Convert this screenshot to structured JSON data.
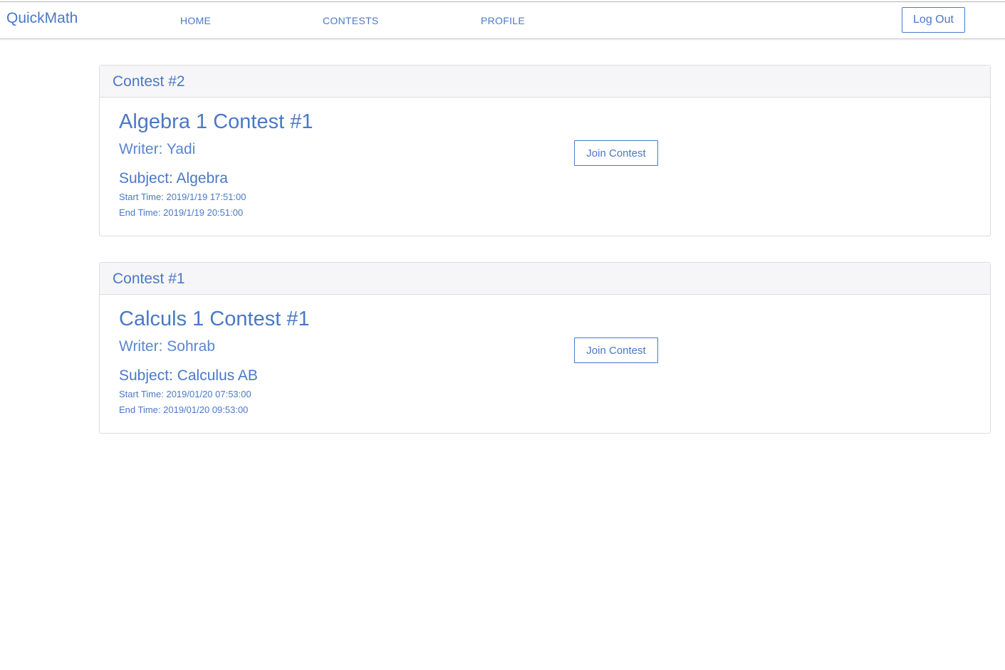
{
  "navbar": {
    "brand": "QuickMath",
    "links": [
      {
        "label": "HOME"
      },
      {
        "label": "CONTESTS"
      },
      {
        "label": "PROFILE"
      }
    ],
    "logout_label": "Log Out"
  },
  "contests": [
    {
      "header": "Contest #2",
      "title": "Algebra 1 Contest #1",
      "writer": "Writer: Yadi",
      "subject": "Subject: Algebra",
      "start_time": "Start Time: 2019/1/19 17:51:00",
      "end_time": "End Time: 2019/1/19 20:51:00",
      "join_label": "Join Contest"
    },
    {
      "header": "Contest #1",
      "title": "Calculs 1 Contest #1",
      "writer": "Writer: Sohrab",
      "subject": "Subject: Calculus AB",
      "start_time": "Start Time: 2019/01/20 07:53:00",
      "end_time": "End Time: 2019/01/20 09:53:00",
      "join_label": "Join Contest"
    }
  ],
  "colors": {
    "accent": "#4a78c8",
    "header_bg": "#f6f6f8",
    "border": "#dcdcdc"
  }
}
